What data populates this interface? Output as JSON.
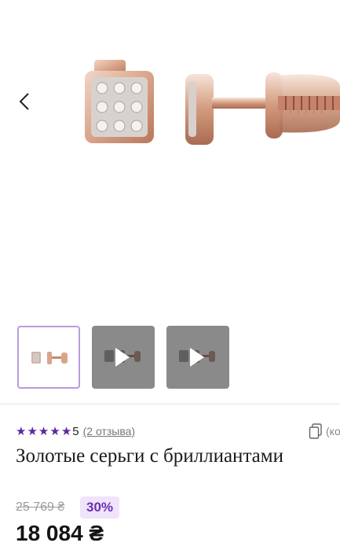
{
  "gallery": {
    "image_name": "rose gold square diamond stud earrings",
    "thumbnails": [
      {
        "type": "image",
        "selected": true
      },
      {
        "type": "video",
        "selected": false
      },
      {
        "type": "video",
        "selected": false
      }
    ]
  },
  "product": {
    "rating_value": "5",
    "stars": [
      "★",
      "★",
      "★",
      "★",
      "★"
    ],
    "reviews": "(2 отзыва)",
    "compare_label": "(ко",
    "title": "Золотые серьги с бриллиантами",
    "old_price": "25 769 ₴",
    "discount": "30%",
    "price": "18 084 ₴"
  },
  "colors": {
    "accent": "#5b2a9b",
    "badge_bg": "#efe4fb",
    "thumb_selected_border": "#b89be0"
  },
  "icons": {
    "prev": "chevron-left-icon",
    "play": "play-icon",
    "star": "star-icon",
    "compare": "compare-icon"
  }
}
